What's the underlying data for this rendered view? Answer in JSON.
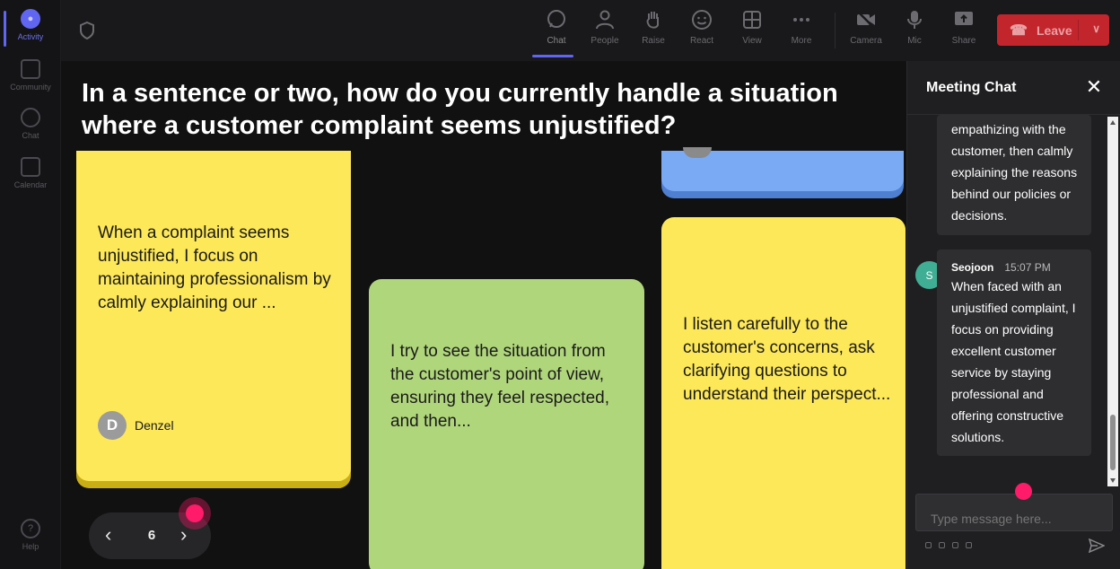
{
  "rail": {
    "items": [
      {
        "label": "Activity",
        "icon": "bell-icon",
        "active": true
      },
      {
        "label": "Community",
        "icon": "community-icon",
        "active": false
      },
      {
        "label": "Chat",
        "icon": "chat-icon",
        "active": false
      },
      {
        "label": "Calendar",
        "icon": "calendar-icon",
        "active": false
      }
    ],
    "help": "Help"
  },
  "toolbar": {
    "chat": "Chat",
    "people": "People",
    "raise": "Raise",
    "react": "React",
    "view": "View",
    "more": "More",
    "camera": "Camera",
    "mic": "Mic",
    "share": "Share",
    "leave": "Leave"
  },
  "stage": {
    "question": "In a sentence or two, how do you currently handle a situation where a customer complaint seems unjustified?",
    "notes": [
      {
        "text": "When a complaint seems unjustified, I focus on maintaining professionalism by calmly explaining our ...",
        "author": "Denzel",
        "author_initial": "D",
        "color": "#fde859"
      },
      {
        "text": "I try to see the situation from the customer's point of view, ensuring they feel respected, and then...",
        "color": "#b0d67c"
      },
      {
        "text": "",
        "color": "#7aaaf4"
      },
      {
        "text": "I listen carefully to the customer's concerns, ask clarifying questions to understand their perspect...",
        "color": "#fde859"
      }
    ],
    "pager": {
      "page": "6"
    }
  },
  "chat": {
    "title": "Meeting Chat",
    "messages": [
      {
        "text": "empathizing with the customer, then calmly explaining the reasons behind our policies or decisions."
      },
      {
        "sender": "Seojoon",
        "initial": "S",
        "time": "15:07 PM",
        "text": "When faced with an unjustified complaint, I focus on providing excellent customer service by staying professional and offering constructive solutions."
      }
    ],
    "input_placeholder": "Type message here..."
  },
  "colors": {
    "accent": "#6166f2",
    "leave": "#c3252d",
    "cursor": "#ff1a6a"
  }
}
